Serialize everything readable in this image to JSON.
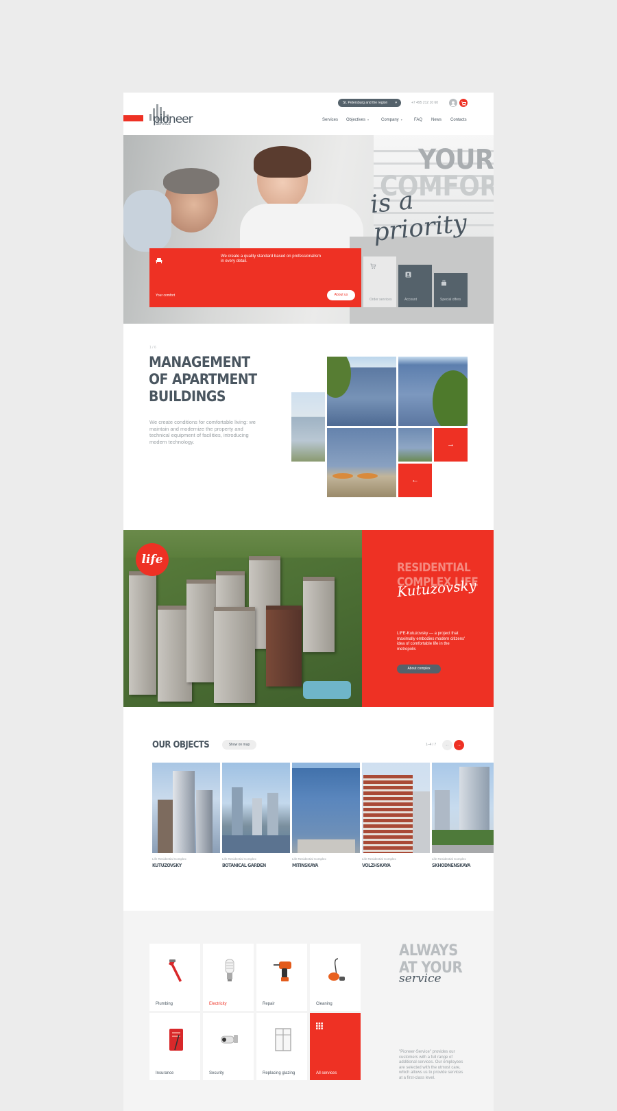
{
  "header": {
    "logo_word": "pioneer",
    "logo_sub": "SERVICE",
    "region": "St. Petersburg and the region",
    "phone": "+7 495 212 10 60",
    "nav": [
      {
        "label": "Services",
        "dropdown": false
      },
      {
        "label": "Objectives",
        "dropdown": true
      },
      {
        "label": "Company",
        "dropdown": true
      },
      {
        "label": "FAQ",
        "dropdown": false
      },
      {
        "label": "News",
        "dropdown": false
      },
      {
        "label": "Contacts",
        "dropdown": false
      }
    ]
  },
  "hero": {
    "title_line1": "YOUR",
    "title_line2": "COMFORT",
    "title_script": "is a priority",
    "card_text": "We create a quality standard based on professionalism in every detail.",
    "card_label": "Your comfort",
    "card_button": "About us",
    "tiles": [
      {
        "label": "Order services",
        "icon": "cart-icon"
      },
      {
        "label": "Account",
        "icon": "account-icon"
      },
      {
        "label": "Special offers",
        "icon": "gift-icon"
      }
    ]
  },
  "management": {
    "counter": "1 / 6",
    "title": "MANAGEMENT OF APARTMENT BUILDINGS",
    "text": "We create conditions for comfortable living: we maintain and modernize the property and technical equipment of facilities, introducing modern technology."
  },
  "life": {
    "badge": "life",
    "title": "RESIDENTIAL COMPLEX LIFE",
    "script": "Kutuzovsky",
    "text": "LIFE-Kutuzovsky — a project that maximally embodies modern citizens' idea of comfortable life in the metropolis",
    "button": "About complex"
  },
  "objects": {
    "title": "OUR OBJECTS",
    "map_button": "Show on map",
    "counter": "1–4 / 7",
    "items": [
      {
        "subtitle": "Life Residential Complex",
        "name": "KUTUZOVSKY"
      },
      {
        "subtitle": "Life Residential Complex",
        "name": "BOTANICAL GARDEN"
      },
      {
        "subtitle": "Life Residential Complex",
        "name": "MITINSKAYA"
      },
      {
        "subtitle": "Life Residential Complex",
        "name": "VOLZHSKAYA"
      },
      {
        "subtitle": "Life Residential Complex",
        "name": "SKHODNENSKAYA"
      }
    ]
  },
  "services": {
    "items": [
      {
        "label": "Plumbing",
        "icon": "wrench-icon"
      },
      {
        "label": "Electricity",
        "icon": "lightbulb-icon"
      },
      {
        "label": "Repair",
        "icon": "drill-icon"
      },
      {
        "label": "Cleaning",
        "icon": "vacuum-icon"
      },
      {
        "label": "Insurance",
        "icon": "policy-icon"
      },
      {
        "label": "Security",
        "icon": "camera-icon"
      },
      {
        "label": "Replacing glazing",
        "icon": "window-icon"
      },
      {
        "label": "All services",
        "icon": "grid-icon"
      }
    ],
    "title_line1": "ALWAYS",
    "title_line2": "AT YOUR",
    "title_script": "service",
    "text": "\"Pioneer-Service\" provides our customers with a full range of additional services. Our employees are selected with the utmost care, which allows us to provide services at a first-class level."
  },
  "colors": {
    "accent": "#ee3124",
    "slate": "#55626b",
    "text": "#4a5660",
    "muted": "#9aa0a4"
  }
}
